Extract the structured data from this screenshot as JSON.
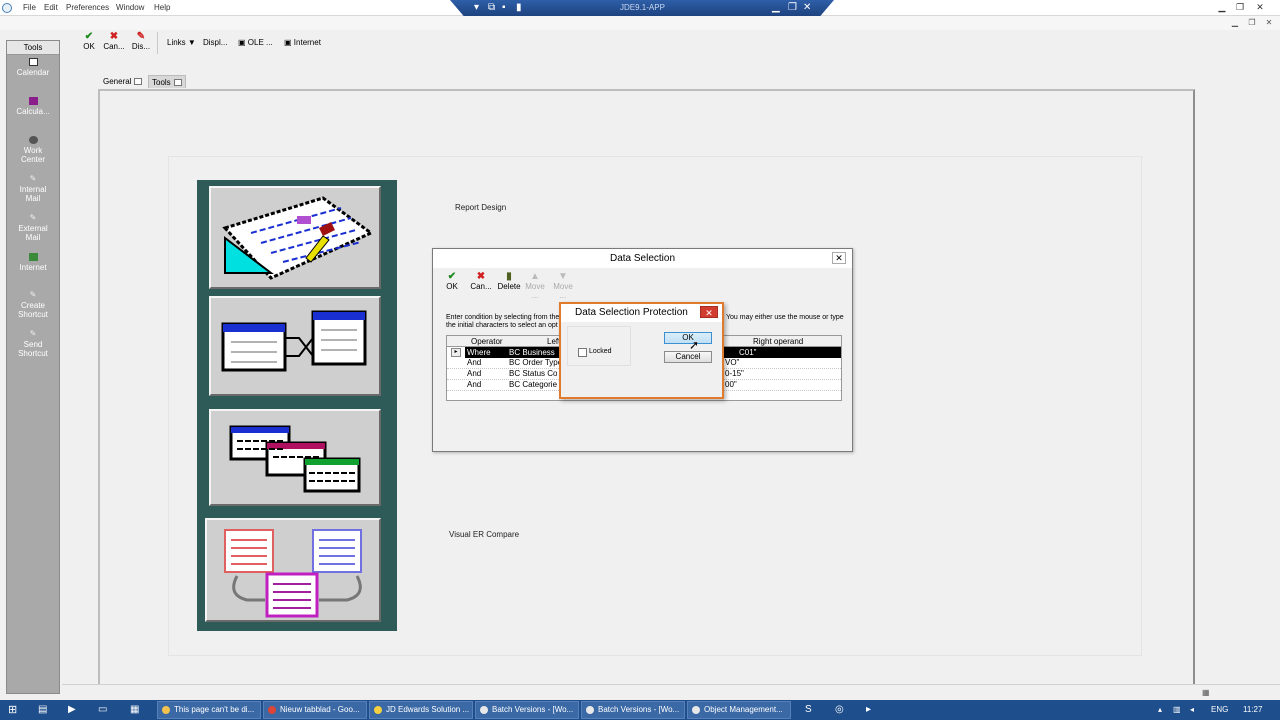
{
  "menubar": {
    "items": [
      "File",
      "Edit",
      "Preferences",
      "Window",
      "Help"
    ]
  },
  "remote_bar": {
    "title": "JDE9.1-APP"
  },
  "tools_panel": {
    "header": "Tools",
    "items": [
      {
        "label": "Calendar",
        "icon": "calendar-icon"
      },
      {
        "label": "Calcula...",
        "icon": "calculator-icon"
      },
      {
        "label": "Work Center",
        "icon": "work-center-icon"
      },
      {
        "label": "Internal Mail",
        "icon": "internal-mail-icon"
      },
      {
        "label": "External Mail",
        "icon": "external-mail-icon"
      },
      {
        "label": "Internet",
        "icon": "internet-icon"
      },
      {
        "label": "Create Shortcut",
        "icon": "create-shortcut-icon"
      },
      {
        "label": "Send Shortcut",
        "icon": "send-shortcut-icon"
      }
    ]
  },
  "toolbar": {
    "ok": "OK",
    "cancel": "Can...",
    "display": "Dis...",
    "links": "Links",
    "displ": "Displ...",
    "ole": "OLE ...",
    "internet": "Internet"
  },
  "tabs": [
    "General",
    "Tools"
  ],
  "launchpad": {
    "report_design": "Report Design",
    "visual_er": "Visual ER Compare"
  },
  "data_selection": {
    "title": "Data Selection",
    "toolbar": {
      "ok": "OK",
      "cancel": "Can...",
      "delete": "Delete",
      "move_up": "Move ...",
      "move_down": "Move ..."
    },
    "instructions_left": "Enter condition by selecting from the",
    "instructions_left2": "the initial characters to select an opt",
    "instructions_right": "You may either use the mouse or type",
    "columns": {
      "operator": "Operator",
      "left": "Left",
      "right": "Right operand"
    },
    "rows": [
      {
        "operator": "Where",
        "left": "BC Business",
        "right": "C01\""
      },
      {
        "operator": "And",
        "left": "BC Order Type",
        "right": "VO\""
      },
      {
        "operator": "And",
        "left": "BC Status Co",
        "right": "0-15\""
      },
      {
        "operator": "And",
        "left": "BC Categorie",
        "right": "00\""
      }
    ]
  },
  "protection": {
    "title": "Data Selection Protection",
    "locked_label": "Locked",
    "ok": "OK",
    "cancel": "Cancel"
  },
  "taskbar": {
    "apps": [
      {
        "label": "This page can't be di...",
        "color": "#f2c14e"
      },
      {
        "label": "Nieuw tabblad - Goo...",
        "color": "#db4437"
      },
      {
        "label": "JD Edwards Solution ...",
        "color": "#f4d03f"
      },
      {
        "label": "Batch Versions - [Wo...",
        "color": "#e8e8e8"
      },
      {
        "label": "Batch Versions - [Wo...",
        "color": "#e8e8e8"
      },
      {
        "label": "Object Management...",
        "color": "#e8e8e8"
      }
    ],
    "lang": "ENG",
    "time": "11:27"
  }
}
